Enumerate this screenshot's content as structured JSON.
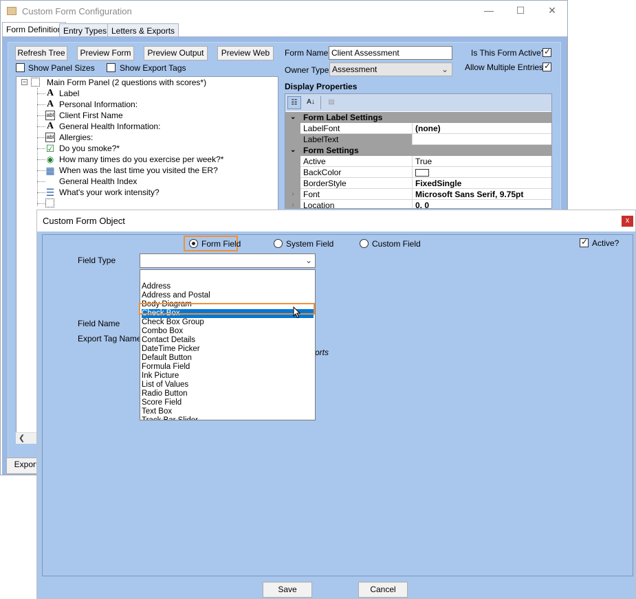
{
  "main_window": {
    "title": "Custom Form Configuration",
    "tabs": [
      "Form Definition",
      "Entry Types",
      "Letters & Exports"
    ],
    "toolbar": {
      "refresh_tree": "Refresh Tree",
      "preview_form": "Preview Form",
      "preview_output": "Preview Output",
      "preview_web": "Preview Web"
    },
    "show_panel_sizes": "Show Panel Sizes",
    "show_export_tags": "Show Export Tags",
    "tree": {
      "root": "Main Form Panel (2 questions with scores*)",
      "items": [
        {
          "icon": "label-icon",
          "label": "Label"
        },
        {
          "icon": "label-icon",
          "label": "Personal Information:"
        },
        {
          "icon": "textbox-icon",
          "label": "Client First Name"
        },
        {
          "icon": "label-icon",
          "label": "General Health Information:"
        },
        {
          "icon": "textbox-icon",
          "label": "Allergies:"
        },
        {
          "icon": "checkbox-icon",
          "label": "Do you smoke?*"
        },
        {
          "icon": "radio-icon",
          "label": "How many times do you exercise per week?*"
        },
        {
          "icon": "datetime-icon",
          "label": "When was the last time you visited the ER?"
        },
        {
          "icon": "none",
          "label": "General Health Index"
        },
        {
          "icon": "listvalues-icon",
          "label": "What's your work intensity?"
        },
        {
          "icon": "panel-icon",
          "label": ""
        }
      ]
    },
    "form_name_label": "Form Name",
    "form_name_value": "Client Assessment",
    "owner_type_label": "Owner Type",
    "owner_type_value": "Assessment",
    "is_active_label": "Is This Form Active?",
    "allow_multiple_label": "Allow Multiple Entries?",
    "display_properties": "Display Properties",
    "props": {
      "cat_label_settings": "Form Label Settings",
      "cat_form_settings": "Form Settings",
      "label_font": {
        "name": "LabelFont",
        "value": "(none)"
      },
      "label_text": {
        "name": "LabelText",
        "value": ""
      },
      "active": {
        "name": "Active",
        "value": "True"
      },
      "back_color": {
        "name": "BackColor",
        "value": ""
      },
      "border_style": {
        "name": "BorderStyle",
        "value": "FixedSingle"
      },
      "font": {
        "name": "Font",
        "value": "Microsoft Sans Serif, 9.75pt"
      },
      "location": {
        "name": "Location",
        "value": "0, 0"
      }
    },
    "export_button": "Export"
  },
  "dialog": {
    "title": "Custom Form Object",
    "close": "x",
    "radio_form_field": "Form Field",
    "radio_system_field": "System Field",
    "radio_custom_field": "Custom Field",
    "active_label": "Active?",
    "field_type_label": "Field Type",
    "field_type_value": "",
    "field_name_label": "Field Name",
    "export_tag_label": "Export Tag Name",
    "partial_text": "orts",
    "options": [
      "Address",
      "Address and Postal",
      "Body Diagram",
      "Check Box",
      "Check Box Group",
      "Combo Box",
      "Contact Details",
      "DateTime Picker",
      "Default Button",
      "Formula Field",
      "Ink Picture",
      "List of Values",
      "Radio Button",
      "Score Field",
      "Text Box",
      "Track Bar Slider"
    ],
    "selected_option": "Check Box",
    "save": "Save",
    "cancel": "Cancel"
  },
  "colors": {
    "panel_blue": "#a9c6ec",
    "highlight_orange": "#f0913a",
    "selection_blue": "#0078d7"
  }
}
